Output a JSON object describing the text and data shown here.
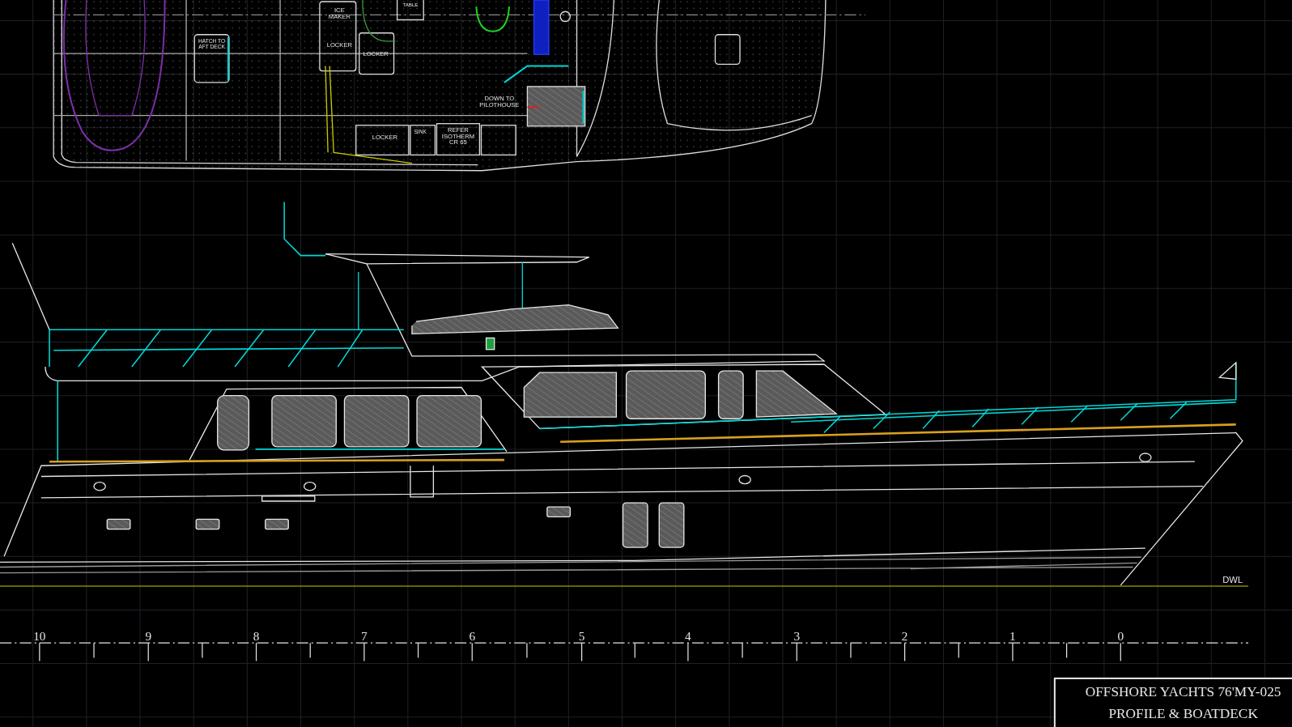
{
  "plan_labels": [
    {
      "lines": [
        "TABLE"
      ]
    },
    {
      "lines": [
        "ICE",
        "MAKER"
      ]
    },
    {
      "lines": [
        "LOCKER"
      ]
    },
    {
      "lines": [
        "LOCKER"
      ]
    },
    {
      "lines": [
        "HATCH TO",
        "AFT DECK"
      ]
    },
    {
      "lines": [
        "DOWN TO",
        "PILOTHOUSE"
      ]
    },
    {
      "lines": [
        "LOCKER"
      ]
    },
    {
      "lines": [
        "SINK"
      ]
    },
    {
      "lines": [
        "REFER",
        "ISOTHERM",
        "CR 65"
      ]
    }
  ],
  "waterline_label": "DWL",
  "station_numbers": [
    "10",
    "9",
    "8",
    "7",
    "6",
    "5",
    "4",
    "3",
    "2",
    "1",
    "0"
  ],
  "title_block": {
    "lines": [
      "OFFSHORE YACHTS 76'MY-025",
      "PROFILE & BOATDECK"
    ]
  }
}
